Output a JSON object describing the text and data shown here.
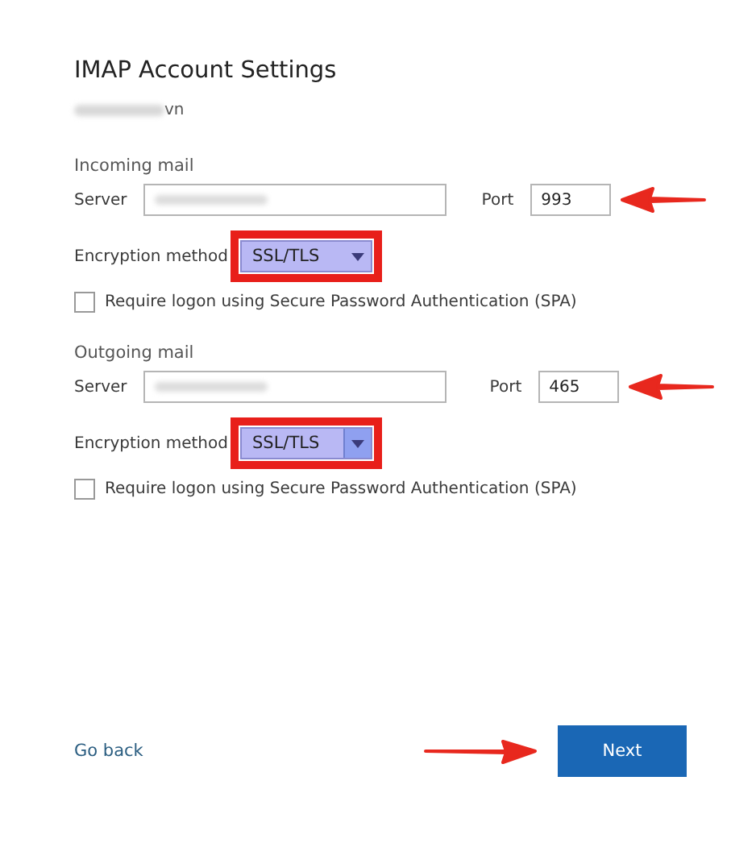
{
  "title": "IMAP Account Settings",
  "account": {
    "visible_suffix": "vn"
  },
  "sections": [
    {
      "heading": "Incoming mail",
      "server_label": "Server",
      "port_label": "Port",
      "port": "993",
      "encryption_label": "Encryption method",
      "encryption": "SSL/TLS",
      "dropdown_hovered": false,
      "spa_label": "Require logon using Secure Password Authentication (SPA)",
      "spa_checked": false
    },
    {
      "heading": "Outgoing mail",
      "server_label": "Server",
      "port_label": "Port",
      "port": "465",
      "encryption_label": "Encryption method",
      "encryption": "SSL/TLS",
      "dropdown_hovered": true,
      "spa_label": "Require logon using Secure Password Authentication (SPA)",
      "spa_checked": false
    }
  ],
  "footer": {
    "back": "Go back",
    "next": "Next"
  }
}
